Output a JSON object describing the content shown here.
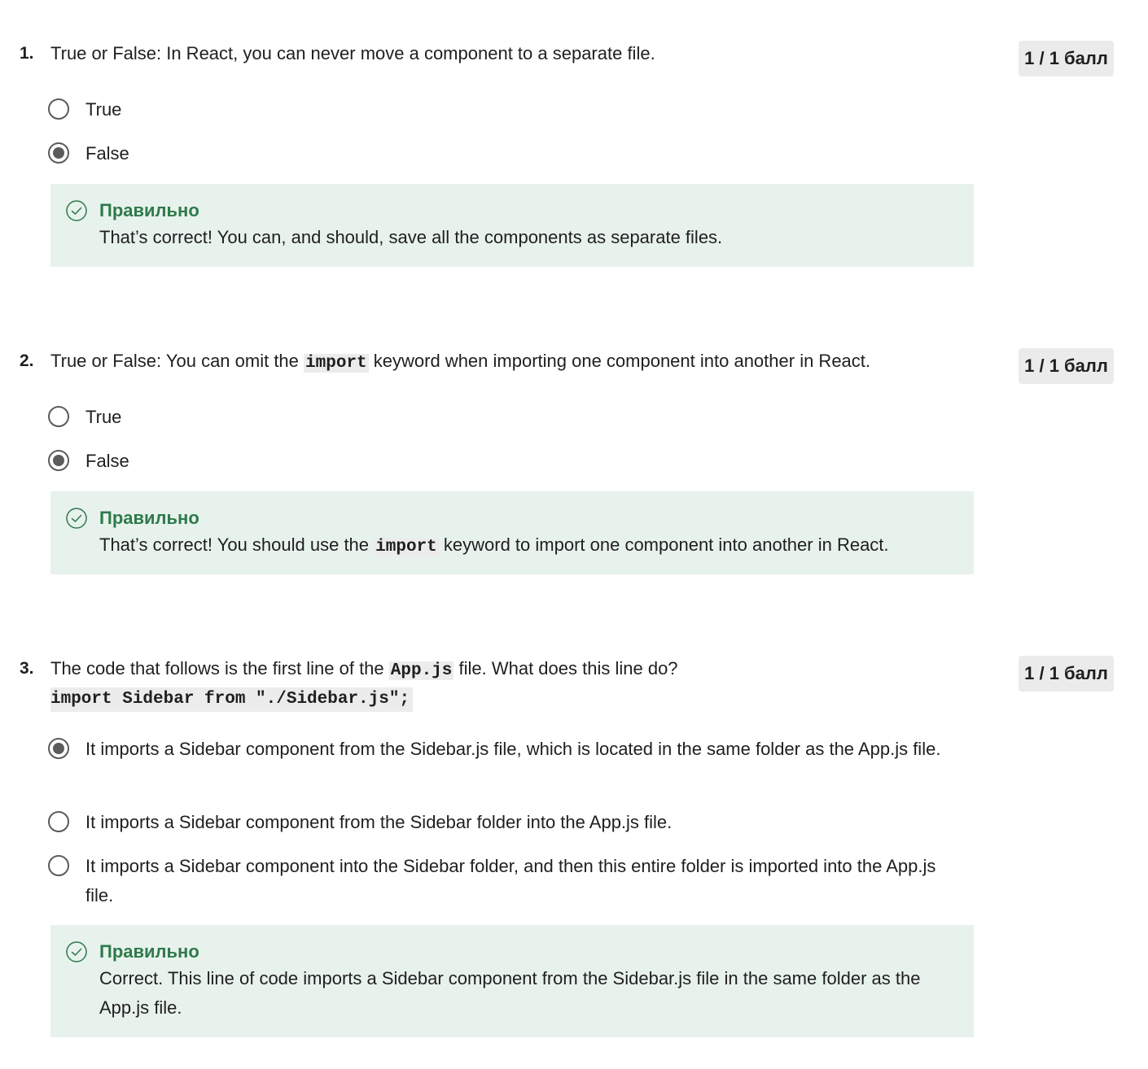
{
  "questions": [
    {
      "number": "1.",
      "text": "True or False: In React, you can never move a component to a separate file.",
      "score": "1 / 1 балл",
      "options": [
        {
          "label": "True",
          "selected": false
        },
        {
          "label": "False",
          "selected": true
        }
      ],
      "feedback": {
        "title": "Правильно",
        "text": "That’s correct! You can, and should, save all the components as separate files."
      }
    },
    {
      "number": "2.",
      "text_before": "True or False: You can omit the ",
      "text_code": "import",
      "text_after": " keyword when importing one component into another in React.",
      "score": "1 / 1 балл",
      "options": [
        {
          "label": "True",
          "selected": false
        },
        {
          "label": "False",
          "selected": true
        }
      ],
      "feedback": {
        "title": "Правильно",
        "text_before": "That’s correct! You should use the ",
        "text_code": "import",
        "text_after": " keyword to import one component into another in React."
      }
    },
    {
      "number": "3.",
      "text_before": "The code that follows is the first line of the ",
      "text_code": "App.js",
      "text_after": " file. What does this line do?",
      "code_block": "import Sidebar from \"./Sidebar.js\";",
      "score": "1 / 1 балл",
      "options": [
        {
          "label": "It imports a Sidebar component from the Sidebar.js file, which is located in the same folder as the App.js file.",
          "selected": true
        },
        {
          "label": "It imports a Sidebar component from the Sidebar folder into the App.js file.",
          "selected": false
        },
        {
          "label": "It imports a Sidebar component into the Sidebar folder, and then this entire folder is imported into the App.js file.",
          "selected": false
        }
      ],
      "feedback": {
        "title": "Правильно",
        "text": "Correct. This line of code imports a Sidebar component from the Sidebar.js file in the same folder as the App.js file."
      }
    }
  ],
  "colors": {
    "feedback_bg": "#e8f2ec",
    "feedback_title": "#2e7a4b",
    "score_bg": "#ebebeb",
    "radio": "#5b5b5b"
  },
  "icons": {
    "feedback": "check-circle-icon",
    "radio_checked": "radio-checked-icon",
    "radio_unchecked": "radio-unchecked-icon"
  }
}
